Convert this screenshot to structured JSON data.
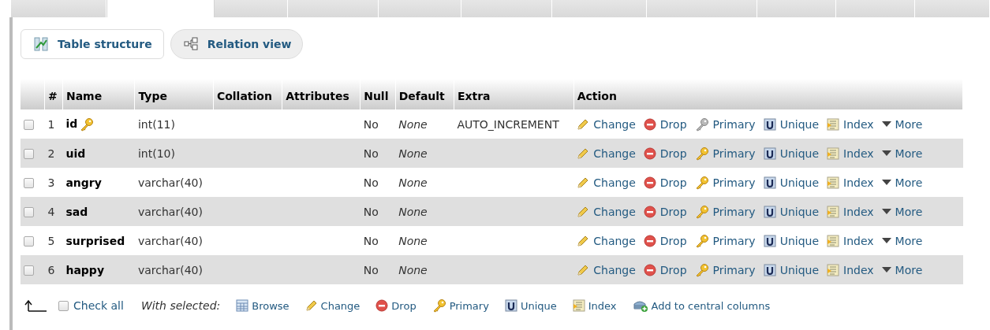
{
  "tabs": [
    {
      "selected": false
    },
    {
      "selected": true
    },
    {
      "selected": false
    },
    {
      "selected": false
    },
    {
      "selected": false
    },
    {
      "selected": false
    },
    {
      "selected": false
    },
    {
      "selected": false
    },
    {
      "selected": false
    },
    {
      "selected": false
    },
    {
      "selected": false
    }
  ],
  "views": [
    {
      "kind": "structure",
      "label": "Table structure",
      "selected": true
    },
    {
      "kind": "relation",
      "label": "Relation view",
      "selected": false
    }
  ],
  "table": {
    "columns": [
      "#",
      "Name",
      "Type",
      "Collation",
      "Attributes",
      "Null",
      "Default",
      "Extra",
      "Action"
    ],
    "rows": [
      {
        "checked": false,
        "index": "1",
        "name": "id",
        "primary_key": true,
        "type": "int(11)",
        "null": "No",
        "default": "None",
        "extra": "AUTO_INCREMENT",
        "actions": [
          {
            "kind": "change",
            "label": "Change"
          },
          {
            "kind": "drop",
            "label": "Drop"
          },
          {
            "kind": "primary",
            "label": "Primary",
            "disabled": true
          },
          {
            "kind": "unique",
            "label": "Unique"
          },
          {
            "kind": "index",
            "label": "Index"
          },
          {
            "kind": "more",
            "label": "More"
          }
        ]
      },
      {
        "checked": false,
        "index": "2",
        "name": "uid",
        "primary_key": false,
        "type": "int(10)",
        "null": "No",
        "default": "None",
        "actions": [
          {
            "kind": "change",
            "label": "Change"
          },
          {
            "kind": "drop",
            "label": "Drop"
          },
          {
            "kind": "primary",
            "label": "Primary",
            "disabled": false
          },
          {
            "kind": "unique",
            "label": "Unique"
          },
          {
            "kind": "index",
            "label": "Index"
          },
          {
            "kind": "more",
            "label": "More"
          }
        ]
      },
      {
        "checked": false,
        "index": "3",
        "name": "angry",
        "primary_key": false,
        "type": "varchar(40)",
        "null": "No",
        "default": "None",
        "actions": [
          {
            "kind": "change",
            "label": "Change"
          },
          {
            "kind": "drop",
            "label": "Drop"
          },
          {
            "kind": "primary",
            "label": "Primary",
            "disabled": false
          },
          {
            "kind": "unique",
            "label": "Unique"
          },
          {
            "kind": "index",
            "label": "Index"
          },
          {
            "kind": "more",
            "label": "More"
          }
        ]
      },
      {
        "checked": false,
        "index": "4",
        "name": "sad",
        "primary_key": false,
        "type": "varchar(40)",
        "null": "No",
        "default": "None",
        "actions": [
          {
            "kind": "change",
            "label": "Change"
          },
          {
            "kind": "drop",
            "label": "Drop"
          },
          {
            "kind": "primary",
            "label": "Primary",
            "disabled": false
          },
          {
            "kind": "unique",
            "label": "Unique"
          },
          {
            "kind": "index",
            "label": "Index"
          },
          {
            "kind": "more",
            "label": "More"
          }
        ]
      },
      {
        "checked": false,
        "index": "5",
        "name": "surprised",
        "primary_key": false,
        "type": "varchar(40)",
        "null": "No",
        "default": "None",
        "actions": [
          {
            "kind": "change",
            "label": "Change"
          },
          {
            "kind": "drop",
            "label": "Drop"
          },
          {
            "kind": "primary",
            "label": "Primary",
            "disabled": false
          },
          {
            "kind": "unique",
            "label": "Unique"
          },
          {
            "kind": "index",
            "label": "Index"
          },
          {
            "kind": "more",
            "label": "More"
          }
        ]
      },
      {
        "checked": false,
        "index": "6",
        "name": "happy",
        "primary_key": false,
        "type": "varchar(40)",
        "null": "No",
        "default": "None",
        "actions": [
          {
            "kind": "change",
            "label": "Change"
          },
          {
            "kind": "drop",
            "label": "Drop"
          },
          {
            "kind": "primary",
            "label": "Primary",
            "disabled": false
          },
          {
            "kind": "unique",
            "label": "Unique"
          },
          {
            "kind": "index",
            "label": "Index"
          },
          {
            "kind": "more",
            "label": "More"
          }
        ]
      }
    ]
  },
  "footer": {
    "check_all": {
      "label": "Check all",
      "checked": false
    },
    "with_selected": "With selected:",
    "actions": [
      {
        "kind": "browse",
        "label": "Browse"
      },
      {
        "kind": "change",
        "label": "Change"
      },
      {
        "kind": "drop",
        "label": "Drop"
      },
      {
        "kind": "primary",
        "label": "Primary"
      },
      {
        "kind": "unique",
        "label": "Unique"
      },
      {
        "kind": "index",
        "label": "Index"
      },
      {
        "kind": "central",
        "label": "Add to central columns"
      }
    ]
  }
}
